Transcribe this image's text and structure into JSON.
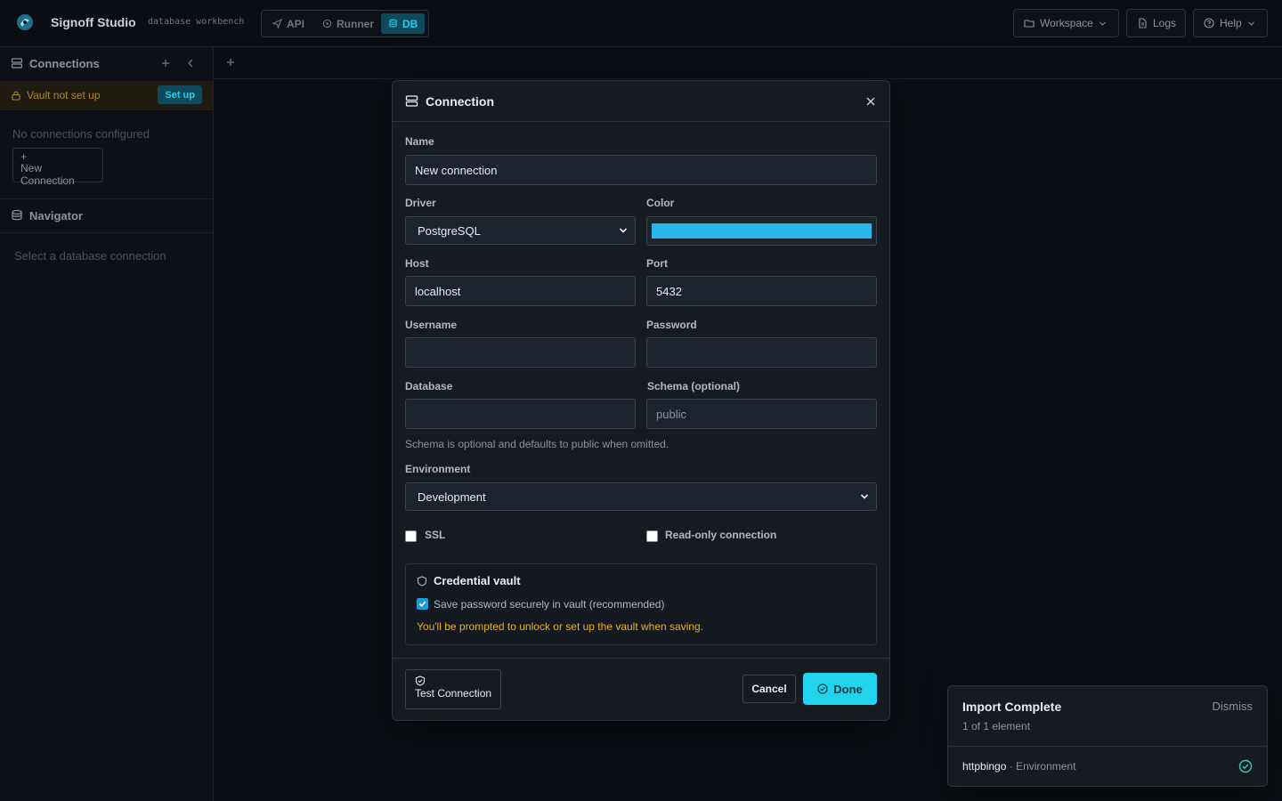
{
  "app": {
    "name": "Signoff Studio",
    "subtitle": "database workbench"
  },
  "modes": [
    {
      "label": "API",
      "icon": "send-icon",
      "active": false
    },
    {
      "label": "Runner",
      "icon": "runner-icon",
      "active": false
    },
    {
      "label": "DB",
      "icon": "database-icon",
      "active": true
    }
  ],
  "top_right": {
    "workspace": "Workspace",
    "logs": "Logs",
    "help": "Help"
  },
  "sidebar": {
    "connections_title": "Connections",
    "vault_warning": "Vault not set up",
    "setup_label": "Set up",
    "empty_connections": "No connections configured",
    "new_connection_plus": "+",
    "new_connection": "New Connection",
    "navigator_title": "Navigator",
    "navigator_empty": "Select a database connection"
  },
  "modal": {
    "title": "Connection",
    "name_label": "Name",
    "name_value": "New connection",
    "driver_label": "Driver",
    "driver_value": "PostgreSQL",
    "color_label": "Color",
    "color_value": "#29b6e8",
    "host_label": "Host",
    "host_value": "localhost",
    "port_label": "Port",
    "port_value": "5432",
    "username_label": "Username",
    "username_value": "",
    "password_label": "Password",
    "password_value": "",
    "database_label": "Database",
    "database_value": "",
    "schema_label": "Schema (optional)",
    "schema_placeholder": "public",
    "schema_hint": "Schema is optional and defaults to public when omitted.",
    "environment_label": "Environment",
    "environment_value": "Development",
    "ssl_label": "SSL",
    "ssl_checked": false,
    "readonly_label": "Read-only connection",
    "readonly_checked": false,
    "vault_title": "Credential vault",
    "vault_save_label": "Save password securely in vault (recommended)",
    "vault_save_checked": true,
    "vault_warning": "You'll be prompted to unlock or set up the vault when saving.",
    "test_button": "Test Connection",
    "cancel_button": "Cancel",
    "done_button": "Done"
  },
  "toast": {
    "title": "Import Complete",
    "subtitle": "1 of 1 element",
    "dismiss": "Dismiss",
    "item_name": "httpbingo",
    "item_separator": " · ",
    "item_type": "Environment",
    "item_status_icon": "check-circle-icon"
  },
  "colors": {
    "accent": "#22d3ee",
    "warning": "#e8b21a",
    "success": "#2dd4bf"
  }
}
